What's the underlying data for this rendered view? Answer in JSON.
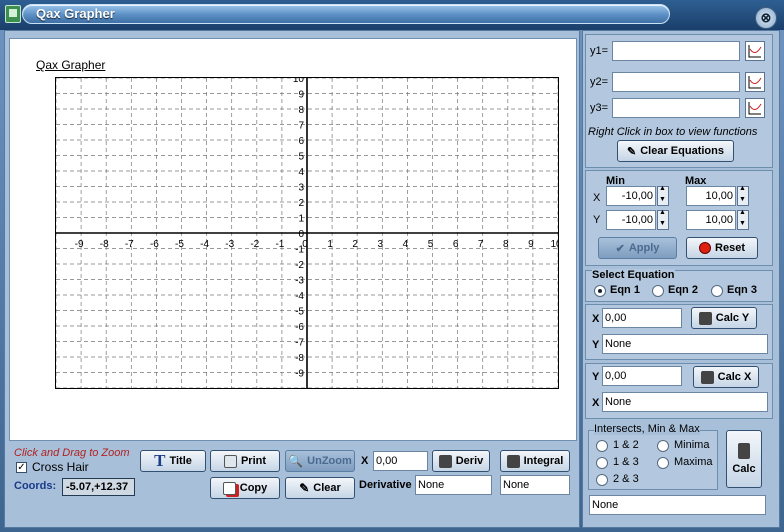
{
  "window": {
    "title": "Qax Grapher",
    "close_glyph": "⊗"
  },
  "graph": {
    "title": "Qax Grapher"
  },
  "chart_data": {
    "type": "line",
    "title": "Qax Grapher",
    "xlim": [
      -10,
      10
    ],
    "ylim": [
      -10,
      10
    ],
    "grid": true,
    "x_ticks": [
      "-9",
      "-8",
      "-7",
      "-6",
      "-5",
      "-4",
      "-3",
      "-2",
      "-1",
      "0",
      "1",
      "2",
      "3",
      "4",
      "5",
      "6",
      "7",
      "8",
      "9",
      "10"
    ],
    "y_ticks": [
      "10",
      "9",
      "8",
      "7",
      "6",
      "5",
      "4",
      "3",
      "2",
      "1",
      "0",
      "-1",
      "-2",
      "-3",
      "-4",
      "-5",
      "-6",
      "-7",
      "-8",
      "-9"
    ],
    "series": []
  },
  "functions": {
    "y1_label": "y1=",
    "y2_label": "y2=",
    "y3_label": "y3=",
    "y1_value": "",
    "y2_value": "",
    "y3_value": "",
    "hint": "Right Click in box to view functions",
    "clear_label": "Clear Equations"
  },
  "range": {
    "min_label": "Min",
    "max_label": "Max",
    "x_label": "X",
    "y_label": "Y",
    "x_min": "-10,00",
    "x_max": "10,00",
    "y_min": "-10,00",
    "y_max": "10,00",
    "apply_label": "Apply",
    "reset_label": "Reset"
  },
  "select_eq": {
    "title": "Select Equation",
    "options": [
      "Eqn 1",
      "Eqn 2",
      "Eqn 3"
    ],
    "selected": "Eqn 1"
  },
  "calc_y": {
    "x_label": "X",
    "x_value": "0,00",
    "button": "Calc Y",
    "y_label": "Y",
    "result": "None"
  },
  "calc_x": {
    "y_label": "Y",
    "y_value": "0,00",
    "button": "Calc X",
    "x_label": "X",
    "result": "None"
  },
  "intersects": {
    "title": "Intersects, Min & Max",
    "options": [
      "1 & 2",
      "1 & 3",
      "2 & 3",
      "Minima",
      "Maxima"
    ],
    "calc_label": "Calc",
    "result": "None"
  },
  "bottom": {
    "zoom_hint": "Click and Drag to Zoom",
    "crosshair_label": "Cross Hair",
    "crosshair_checked": true,
    "coords_label": "Coords:",
    "coords_value": "-5.07,+12.37",
    "title_btn": "Title",
    "print_btn": "Print",
    "unzoom_btn": "UnZoom",
    "copy_btn": "Copy",
    "clear_btn": "Clear",
    "x_label": "X",
    "x_value": "0,00",
    "deriv_btn": "Deriv",
    "integral_btn": "Integral",
    "derivative_label": "Derivative",
    "derivative_value": "None",
    "integral_value": "None"
  },
  "colors": {
    "accent": "#3e6590",
    "panel": "#a7bfd8"
  }
}
